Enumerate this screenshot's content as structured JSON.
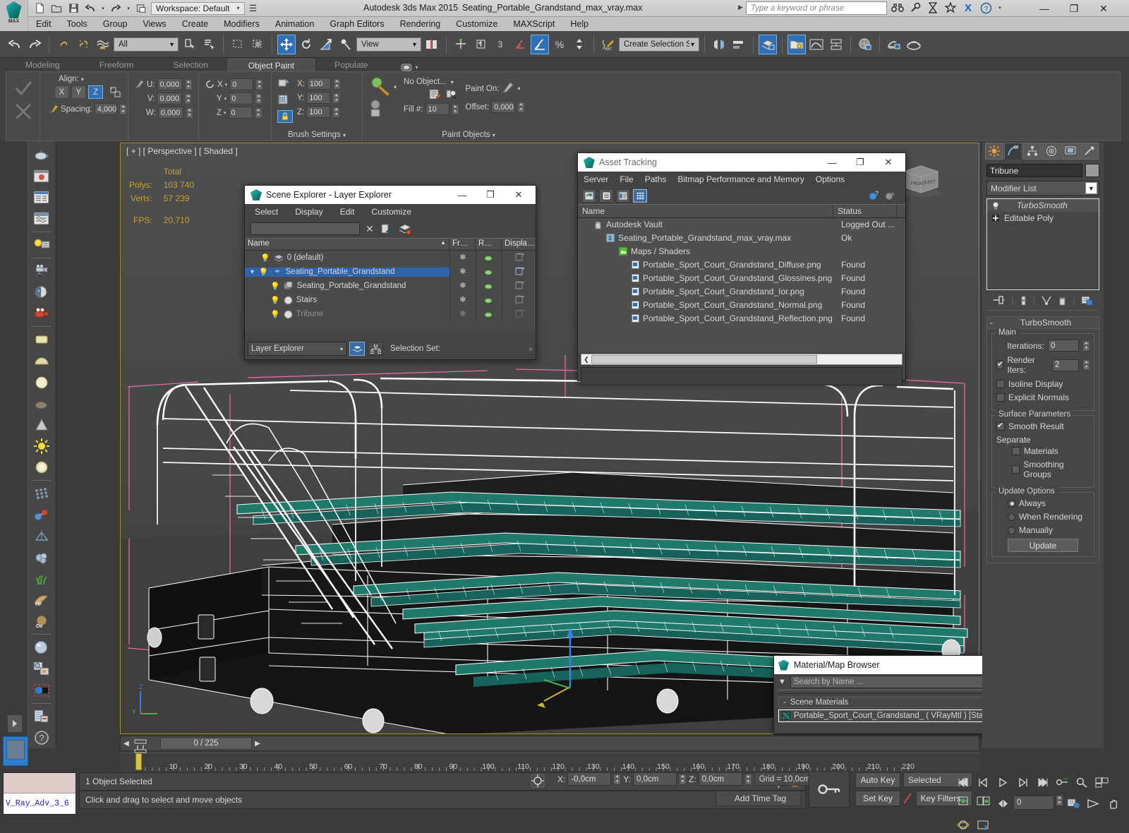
{
  "titlebar": {
    "app_title": "Autodesk 3ds Max  2015",
    "file_title": "Seating_Portable_Grandstand_max_vray.max",
    "workspace": "Workspace: Default",
    "search_placeholder": "Type a keyword or phrase",
    "quick_icons": [
      "new-icon",
      "open-icon",
      "save-icon",
      "undo-icon",
      "redo-icon",
      "set-project-icon"
    ],
    "title_icons": [
      "binoculars-icon",
      "wrench-icon",
      "hourglass-icon",
      "star-icon",
      "x-exchange-icon",
      "help-icon"
    ],
    "window_controls": {
      "minimize": "—",
      "maximize": "❐",
      "close": "✕"
    }
  },
  "menubar": {
    "items": [
      "Edit",
      "Tools",
      "Group",
      "Views",
      "Create",
      "Modifiers",
      "Animation",
      "Graph Editors",
      "Rendering",
      "Customize",
      "MAXScript",
      "Help"
    ]
  },
  "toolbar": {
    "selection_filter": "All",
    "ref_coord_system": "View",
    "named_selection_set": "Create Selection Se",
    "sub_number": "3"
  },
  "ribbon": {
    "tabs": [
      {
        "label": "Modeling",
        "active": false
      },
      {
        "label": "Freeform",
        "active": false
      },
      {
        "label": "Selection",
        "active": false
      },
      {
        "label": "Object Paint",
        "active": true
      },
      {
        "label": "Populate",
        "active": false
      }
    ],
    "align_label": "Align:",
    "axis_buttons": [
      {
        "label": "X",
        "on": false
      },
      {
        "label": "Y",
        "on": false
      },
      {
        "label": "Z",
        "on": true
      }
    ],
    "spacing_label": "Spacing:",
    "spacing_value": "4,000",
    "scatter": [
      {
        "label": "U:",
        "value": "0,000"
      },
      {
        "label": "V:",
        "value": "0,000"
      },
      {
        "label": "W:",
        "value": "0,000"
      }
    ],
    "rotation": [
      {
        "label": "X",
        "value": "0"
      },
      {
        "label": "Y",
        "value": "0"
      },
      {
        "label": "Z",
        "value": "0"
      }
    ],
    "scale": [
      {
        "label": "X:",
        "value": "100"
      },
      {
        "label": "Y:",
        "value": "100"
      },
      {
        "label": "Z:",
        "value": "100"
      }
    ],
    "group_brush_settings": "Brush Settings",
    "group_paint_objects": "Paint Objects",
    "object_picker": "No Object...",
    "fill_label": "Fill #:",
    "fill_value": "10",
    "paint_on_label": "Paint On:",
    "offset_label": "Offset:",
    "offset_value": "0,000"
  },
  "left_toolbar": {
    "icons": [
      "teapot-icon",
      "render-frame-icon",
      "render-setup-icon",
      "render-settings-icon",
      "light-lister-icon",
      "camera-icon",
      "sphere-light-icon",
      "render-camera-icon",
      "plane-primitive-icon",
      "dome-primitive-icon",
      "sphere-primitive-icon",
      "teapot-wire-icon",
      "cone-primitive-icon",
      "sun-icon",
      "light-sphere-icon",
      "grid-array-icon",
      "atom-icon",
      "pyramid-icon",
      "cloud-icon",
      "grass-icon",
      "hair-fur-icon",
      "ox-hair-icon",
      "material-sphere-icon",
      "material-editor-icon",
      "select-by-material-icon",
      "script-icon",
      "help-icon"
    ]
  },
  "viewport": {
    "label": "[ + ] [ Perspective ] [ Shaded ]",
    "stats": {
      "total_header": "Total",
      "polys_label": "Polys:",
      "polys_value": "103 740",
      "verts_label": "Verts:",
      "verts_value": "57 239",
      "fps_label": "FPS:",
      "fps_value": "20,710"
    },
    "axis": {
      "z": "Z",
      "x": "X",
      "y": "Y"
    },
    "navcube": {
      "front": "FRONT",
      "left": "LEFT"
    },
    "model_colors": {
      "seat_green": "#1f7a6b",
      "frame_white": "#ffffff",
      "gizmo_pink": "#f06ba8",
      "bg": "#484848"
    }
  },
  "scene_explorer": {
    "title": "Scene Explorer - Layer Explorer",
    "menu": [
      "Select",
      "Display",
      "Edit",
      "Customize"
    ],
    "search_value": "",
    "columns": [
      "Name",
      "Fr…",
      "R…",
      "Displa…"
    ],
    "rows": [
      {
        "name": "0 (default)",
        "indent": 1,
        "icon": "layer-icon",
        "selected": false,
        "dim": false
      },
      {
        "name": "Seating_Portable_Grandstand",
        "indent": 1,
        "icon": "layer-icon",
        "selected": true,
        "dim": false,
        "expanded": true
      },
      {
        "name": "Seating_Portable_Grandstand",
        "indent": 2,
        "icon": "group-icon",
        "selected": false,
        "dim": false
      },
      {
        "name": "Stairs",
        "indent": 2,
        "icon": "object-icon",
        "selected": false,
        "dim": false
      },
      {
        "name": "Tribune",
        "indent": 2,
        "icon": "object-icon",
        "selected": false,
        "dim": true
      }
    ],
    "footer_combo": "Layer Explorer",
    "selection_set_label": "Selection Set:",
    "window_controls": {
      "minimize": "—",
      "maximize": "❐",
      "close": "✕"
    }
  },
  "asset_tracking": {
    "title": "Asset Tracking",
    "menu": [
      "Server",
      "File",
      "Paths",
      "Bitmap Performance and Memory",
      "Options"
    ],
    "toolbar_icons": [
      "refresh-icon",
      "list-view-icon",
      "detail-view-icon",
      "grid-view-icon"
    ],
    "help_icons": [
      "help-icon",
      "pin-icon"
    ],
    "columns": [
      "Name",
      "Status"
    ],
    "rows": [
      {
        "name": "Autodesk Vault",
        "status": "Logged Out ...",
        "indent": 1,
        "icon": "vault-icon"
      },
      {
        "name": "Seating_Portable_Grandstand_max_vray.max",
        "status": "Ok",
        "indent": 2,
        "icon": "max-file-icon"
      },
      {
        "name": "Maps / Shaders",
        "status": "",
        "indent": 3,
        "icon": "maps-icon"
      },
      {
        "name": "Portable_Sport_Court_Grandstand_Diffuse.png",
        "status": "Found",
        "indent": 4,
        "icon": "bitmap-icon"
      },
      {
        "name": "Portable_Sport_Court_Grandstand_Glossines.png",
        "status": "Found",
        "indent": 4,
        "icon": "bitmap-icon"
      },
      {
        "name": "Portable_Sport_Court_Grandstand_Ior.png",
        "status": "Found",
        "indent": 4,
        "icon": "bitmap-icon"
      },
      {
        "name": "Portable_Sport_Court_Grandstand_Normal.png",
        "status": "Found",
        "indent": 4,
        "icon": "bitmap-icon"
      },
      {
        "name": "Portable_Sport_Court_Grandstand_Reflection.png",
        "status": "Found",
        "indent": 4,
        "icon": "bitmap-icon"
      },
      {
        "name": "",
        "status": "",
        "indent": 0,
        "icon": ""
      },
      {
        "name": "",
        "status": "",
        "indent": 0,
        "icon": ""
      }
    ],
    "window_controls": {
      "minimize": "—",
      "maximize": "❐",
      "close": "✕"
    }
  },
  "material_browser": {
    "title": "Material/Map Browser",
    "search_placeholder": "Search by Name ...",
    "group_label": "Scene Materials",
    "item_label": "Portable_Sport_Court_Grandstand_  ( VRayMtl ) [Stairs, Tribune]",
    "close": "✕"
  },
  "command_panel": {
    "tabs": [
      "create-tab",
      "modify-tab",
      "hierarchy-tab",
      "motion-tab",
      "display-tab",
      "utilities-tab"
    ],
    "active_tab_index": 1,
    "object_name": "Tribune",
    "modifier_list": "Modifier List",
    "stack": [
      {
        "label": "TurboSmooth",
        "icon": "lightbulb-icon",
        "italic": true
      },
      {
        "label": "Editable Poly",
        "icon": "plus-box-icon",
        "italic": false
      }
    ],
    "stack_buttons": [
      "pin-stack-icon",
      "show-end-result-icon",
      "make-unique-icon",
      "remove-modifier-icon",
      "configure-sets-icon"
    ],
    "rollup": {
      "title": "TurboSmooth",
      "collapse_sign": "-",
      "main_group": "Main",
      "iterations_label": "Iterations:",
      "iterations_value": "0",
      "render_iters_label": "Render Iters:",
      "render_iters_value": "2",
      "render_iters_checked": true,
      "isoline_label": "Isoline Display",
      "isoline_checked": false,
      "explicit_label": "Explicit Normals",
      "explicit_checked": false,
      "surface_group": "Surface Parameters",
      "smooth_result_label": "Smooth Result",
      "smooth_result_checked": true,
      "separate_label": "Separate",
      "materials_label": "Materials",
      "materials_checked": false,
      "smoothing_groups_label": "Smoothing Groups",
      "smoothing_groups_checked": false,
      "update_group": "Update Options",
      "update_options": [
        {
          "label": "Always",
          "on": true
        },
        {
          "label": "When Rendering",
          "on": false
        },
        {
          "label": "Manually",
          "on": false
        }
      ],
      "update_button": "Update"
    }
  },
  "timeline": {
    "current_frame_text": "0 / 225",
    "prev_arrow": "◀",
    "next_arrow": "▶",
    "ruler_labels": [
      "10",
      "20",
      "30",
      "40",
      "50",
      "60",
      "70",
      "80",
      "90",
      "100",
      "110",
      "120",
      "130",
      "140",
      "150",
      "160",
      "170",
      "180",
      "190",
      "200",
      "210",
      "220"
    ],
    "ruler_start": "0"
  },
  "status_bar": {
    "mini_listener_value": "V_Ray_Adv_3_6",
    "status_text": "1 Object Selected",
    "prompt_text": "Click and drag to select and move objects",
    "coords": [
      {
        "label": "X:",
        "value": "-0,0cm"
      },
      {
        "label": "Y:",
        "value": "0,0cm"
      },
      {
        "label": "Z:",
        "value": "0,0cm"
      }
    ],
    "grid_text": "Grid = 10,0cm",
    "add_time_tag": "Add Time Tag",
    "auto_key": "Auto Key",
    "set_key": "Set Key",
    "key_mode": "Selected",
    "key_filters": "Key Filters...",
    "frame_field": "0",
    "icons": [
      "pin-icon",
      "lock-icon",
      "abs-rel-icon",
      "key-icon"
    ],
    "nav_icons": [
      "goto-start-icon",
      "prev-frame-icon",
      "play-icon",
      "next-frame-icon",
      "goto-end-icon",
      "key-mode-icon",
      "zoom-icon",
      "zoom-all-icon",
      "zoom-extents-icon",
      "zoom-extents-all-icon",
      "field-of-view-icon",
      "pan-icon",
      "orbit-icon",
      "maximize-viewport-icon"
    ]
  }
}
